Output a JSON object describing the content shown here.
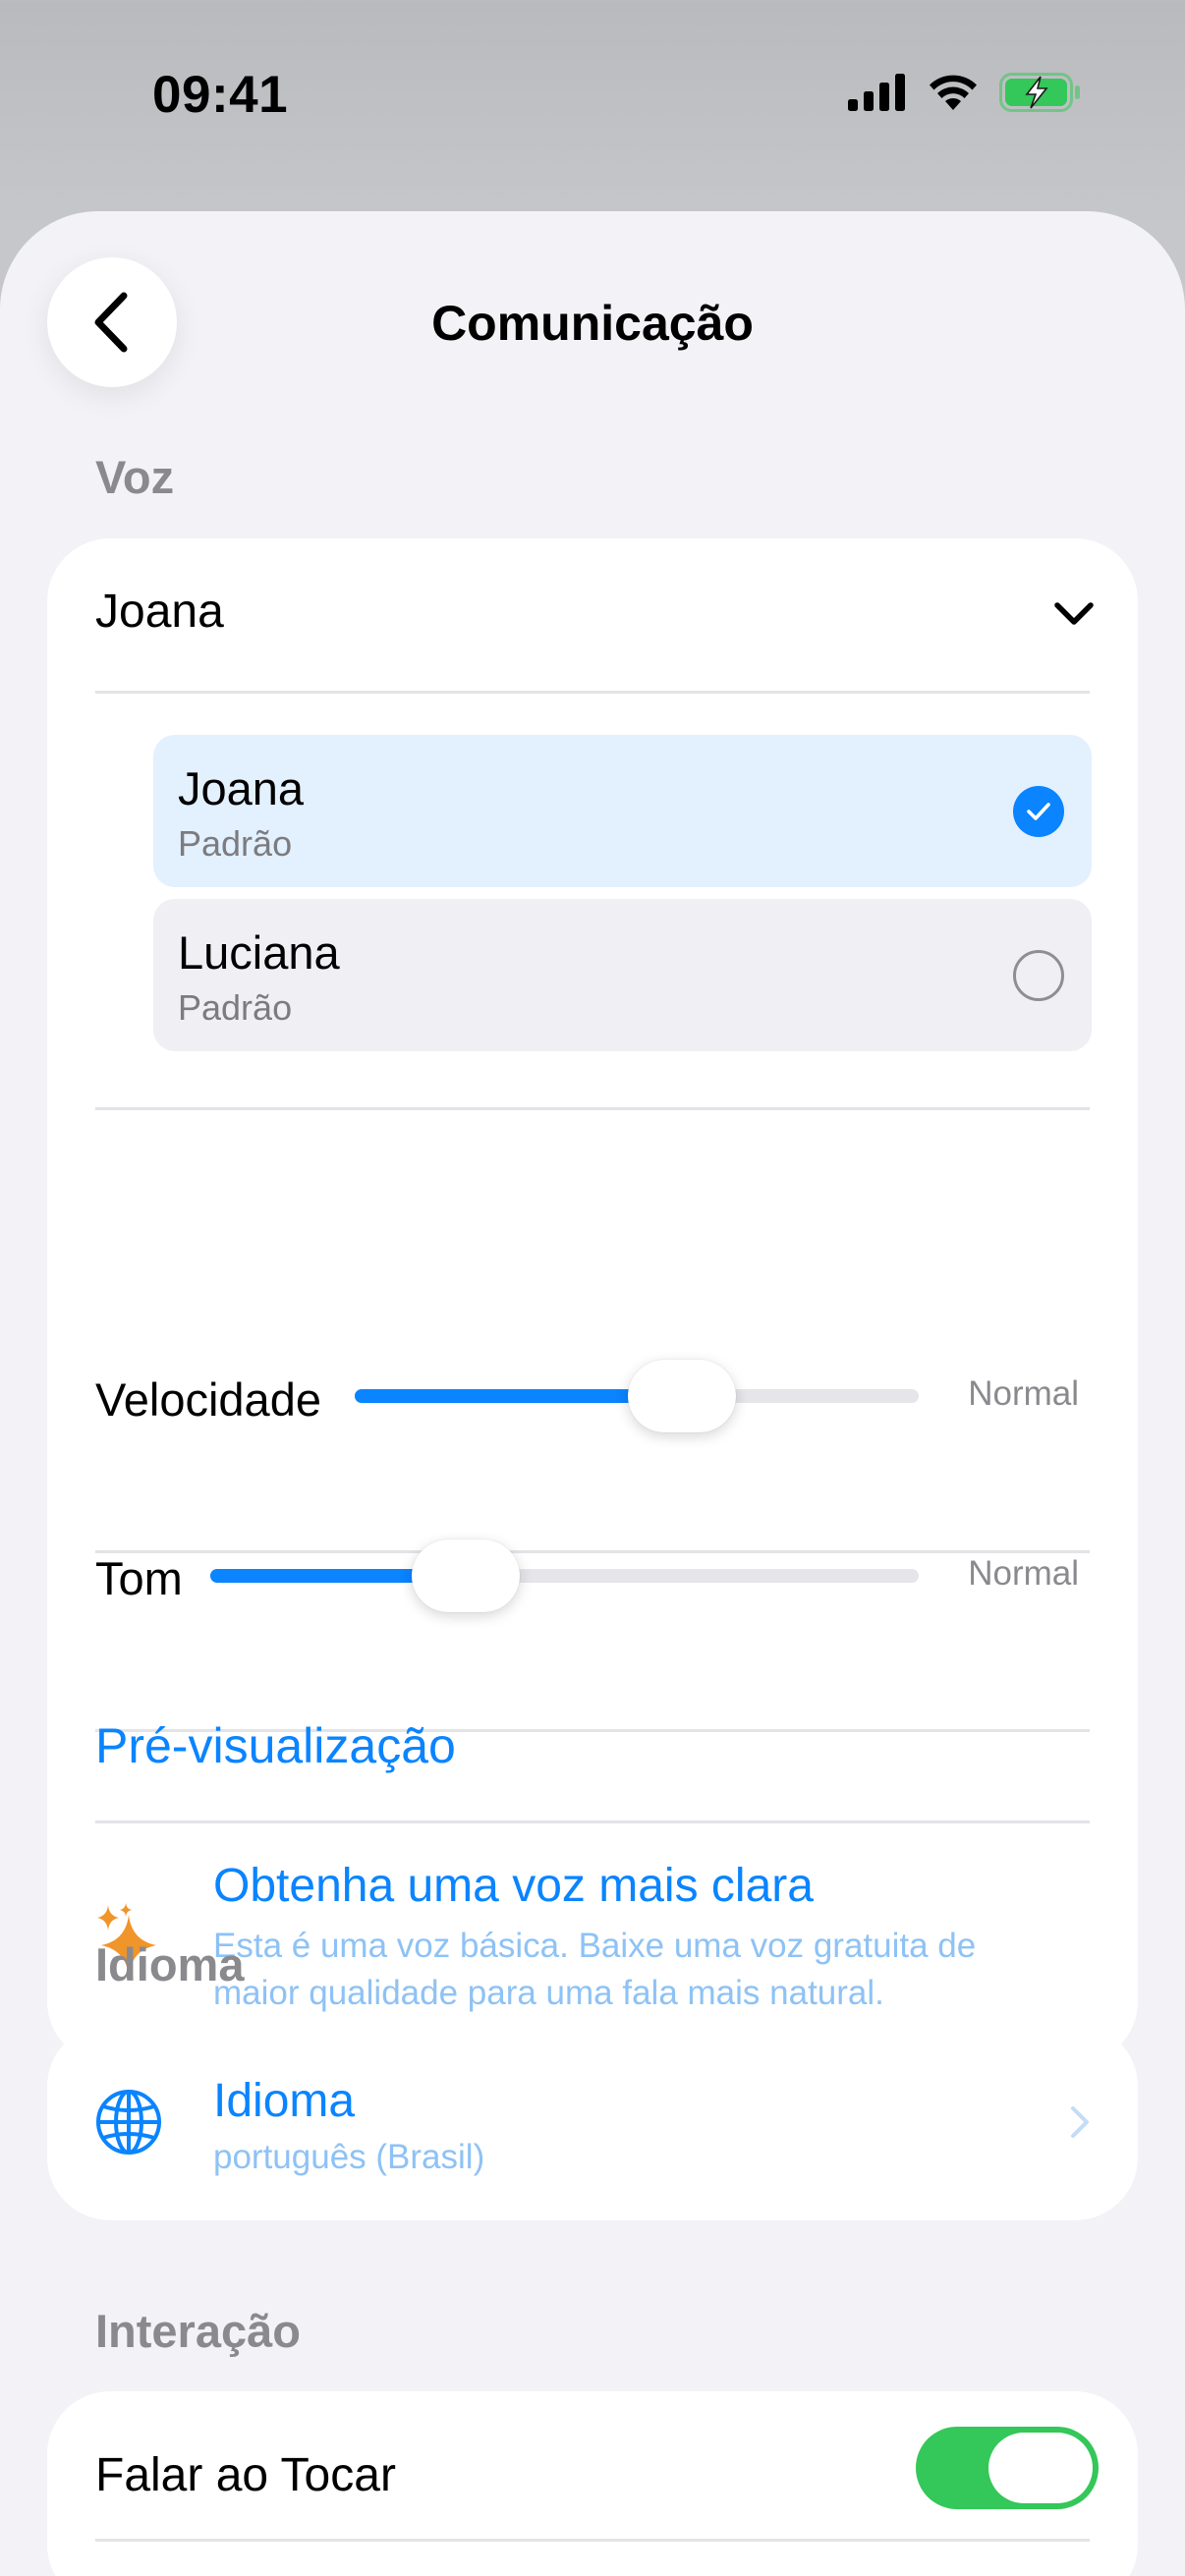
{
  "status_bar": {
    "time": "09:41"
  },
  "nav": {
    "title": "Comunicação"
  },
  "voice_section": {
    "header": "Voz",
    "selected_voice": "Joana",
    "options": [
      {
        "name": "Joana",
        "subtitle": "Padrão",
        "selected": true
      },
      {
        "name": "Luciana",
        "subtitle": "Padrão",
        "selected": false
      }
    ],
    "speed": {
      "label": "Velocidade",
      "value_label": "Normal",
      "level": 0.58
    },
    "pitch": {
      "label": "Tom",
      "value_label": "Normal",
      "level": 0.36
    },
    "preview_label": "Pré-visualização",
    "upgrade": {
      "title": "Obtenha uma voz mais clara",
      "line1": "Esta é uma voz básica. Baixe uma voz gratuita de",
      "line2": "maior qualidade para uma fala mais natural."
    }
  },
  "language_section": {
    "header": "Idioma",
    "row_title": "Idioma",
    "row_value": "português (Brasil)"
  },
  "interaction_section": {
    "header": "Interação",
    "speak_on_touch_label": "Falar ao Tocar",
    "speak_on_touch_on": true
  },
  "colors": {
    "accent": "#0a84ff",
    "toggle_on": "#34c759",
    "sparkle": "#f0952a"
  }
}
